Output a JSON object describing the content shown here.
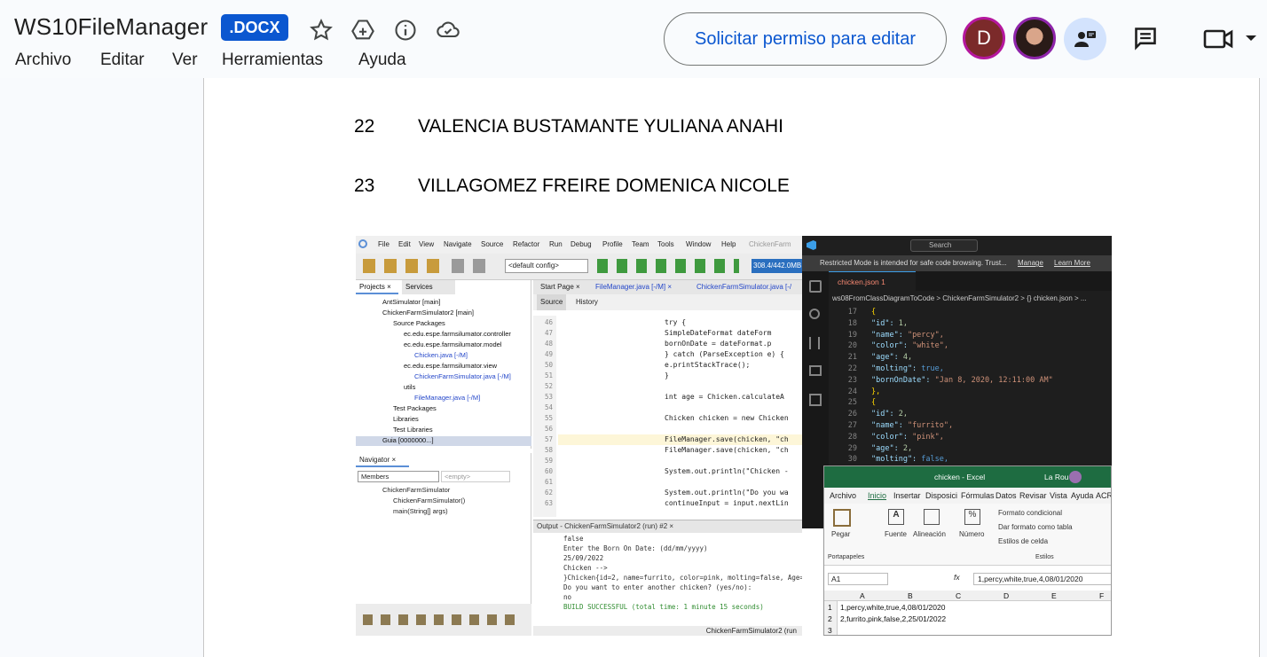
{
  "header": {
    "title": "WS10FileManager",
    "badge": ".DOCX",
    "menu": [
      "Archivo",
      "Editar",
      "Ver",
      "Herramientas",
      "Ayuda"
    ],
    "request_button": "Solicitar permiso para editar",
    "avatar_letter": "D"
  },
  "document": {
    "rows": [
      {
        "num": "22",
        "name": "VALENCIA BUSTAMANTE YULIANA ANAHI"
      },
      {
        "num": "23",
        "name": "VILLAGOMEZ FREIRE DOMENICA NICOLE"
      }
    ]
  },
  "screenshot": {
    "netbeans": {
      "menu": [
        "File",
        "Edit",
        "View",
        "Navigate",
        "Source",
        "Refactor",
        "Run",
        "Debug",
        "Profile",
        "Team",
        "Tools",
        "Window",
        "Help",
        "ChickenFarm"
      ],
      "config": "<default config>",
      "memory": "308.4/442.0MB",
      "tabs_left": [
        "Projects ×",
        "Services"
      ],
      "tree": [
        "AntSimulator [main]",
        "ChickenFarmSimulator2 [main]",
        "Source Packages",
        "ec.edu.espe.farmsilumator.controller",
        "ec.edu.espe.farmsilumator.model",
        "Chicken.java [-/M]",
        "ec.edu.espe.farmsilumator.view",
        "ChickenFarmSimulator.java [-/M]",
        "utils",
        "FileManager.java [-/M]",
        "Test Packages",
        "Libraries",
        "Test Libraries",
        "Guia [0000000...]"
      ],
      "navigator_tab": "Navigator ×",
      "navigator_select": "Members",
      "navigator_empty": "<empty>",
      "navigator_items": [
        "ChickenFarmSimulator",
        "ChickenFarmSimulator()",
        "main(String[] args)"
      ],
      "editor_tabs": [
        "Start Page ×",
        "FileManager.java [-/M] ×",
        "ChickenFarmSimulator.java [-/"
      ],
      "editor_subtabs": [
        "Source",
        "History"
      ],
      "line_numbers": [
        "46",
        "47",
        "48",
        "49",
        "50",
        "51",
        "52",
        "53",
        "54",
        "55",
        "56",
        "57",
        "58",
        "59",
        "60",
        "61",
        "62",
        "63"
      ],
      "code": [
        "try {",
        "    SimpleDateFormat dateForm",
        "    bornOnDate = dateFormat.p",
        "} catch (ParseException e) {",
        "    e.printStackTrace();",
        "}",
        "",
        "int age = Chicken.calculateA",
        "",
        "Chicken chicken = new Chicken",
        "",
        "FileManager.save(chicken, \"ch",
        "FileManager.save(chicken, \"ch",
        "",
        "System.out.println(\"Chicken -",
        "",
        "System.out.println(\"Do you wa",
        "continueInput = input.nextLin"
      ],
      "output_tab": "Output - ChickenFarmSimulator2 (run) #2 ×",
      "output": [
        "false",
        "Enter the Born On Date: (dd/mm/yyyy)",
        "25/09/2022",
        "Chicken -->",
        "}Chicken{id=2, name=furrito, color=pink, molting=false, Age=",
        "Do you want to enter another chicken? (yes/no):",
        "no",
        "BUILD SUCCESSFUL (total time: 1 minute 15 seconds)"
      ],
      "status": "ChickenFarmSimulator2 (run"
    },
    "vscode": {
      "search": "Search",
      "warning": "Restricted Mode is intended for safe code browsing. Trust...",
      "manage": "Manage",
      "learn_more": "Learn More",
      "tab": "chicken.json 1",
      "breadcrumb": "ws08FromClassDiagramToCode > ChickenFarmSimulator2 > {} chicken.json > ...",
      "line_numbers": [
        "17",
        "18",
        "19",
        "20",
        "21",
        "22",
        "23",
        "24",
        "25",
        "26",
        "27",
        "28",
        "29",
        "30"
      ],
      "lines": [
        "{",
        "  \"id\": 1,",
        "  \"name\": \"percy\",",
        "  \"color\": \"white\",",
        "  \"age\": 4,",
        "  \"molting\": true,",
        "  \"bornOnDate\": \"Jan 8, 2020, 12:11:00 AM\"",
        "},",
        "{",
        "  \"id\": 2,",
        "  \"name\": \"furrito\",",
        "  \"color\": \"pink\",",
        "  \"age\": 2,",
        "  \"molting\": false,"
      ]
    },
    "excel": {
      "title": "chicken - Excel",
      "user": "La Rou",
      "menu": [
        "Archivo",
        "Inicio",
        "Insertar",
        "Disposici",
        "Fórmulas",
        "Datos",
        "Revisar",
        "Vista",
        "Ayuda",
        "ACR"
      ],
      "ribbon": [
        "Pegar",
        "Fuente",
        "Alineación",
        "Número"
      ],
      "styles": [
        "Formato condicional",
        "Dar formato como tabla",
        "Estilos de celda"
      ],
      "group_clip": "Portapapeles",
      "group_styles": "Estilos",
      "cell_ref": "A1",
      "formula": "1,percy,white,true,4,08/01/2020",
      "columns": [
        "A",
        "B",
        "C",
        "D",
        "E",
        "F"
      ],
      "rows": [
        "1,percy,white,true,4,08/01/2020",
        "2,furrito,pink,false,2,25/01/2022"
      ]
    }
  }
}
